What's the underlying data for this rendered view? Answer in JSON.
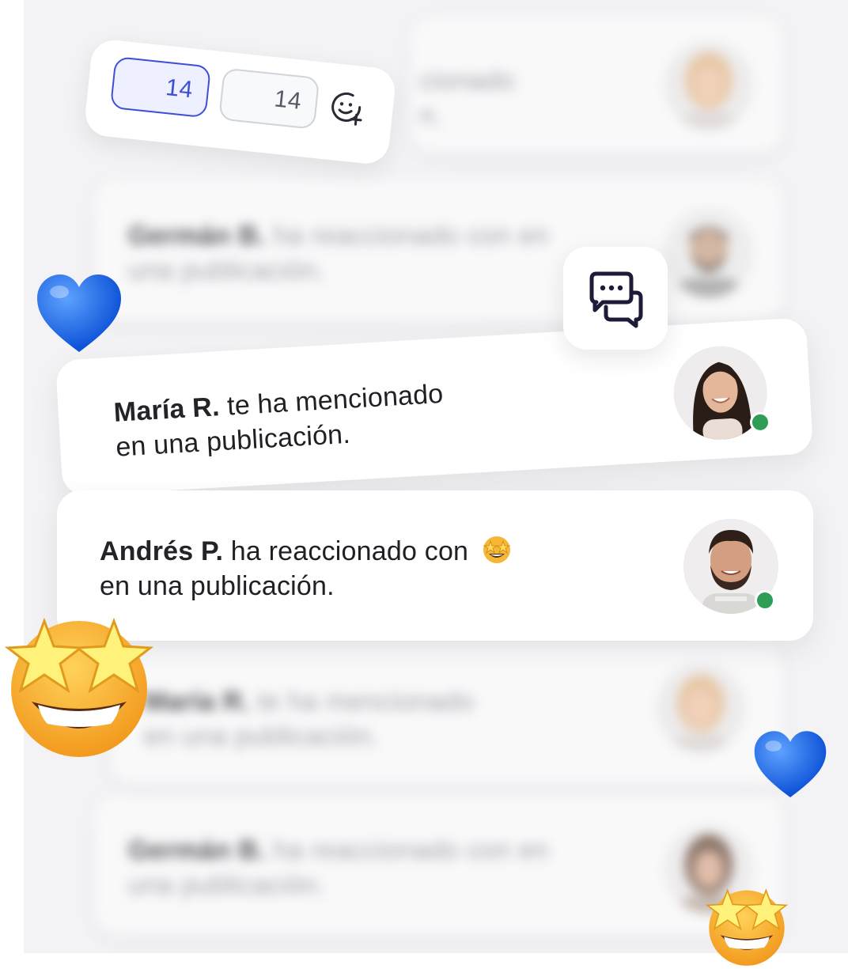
{
  "reactions": {
    "count_primary": "14",
    "count_secondary": "14",
    "add_reaction_icon": "emoji-add-icon"
  },
  "chat_icon": "chat-bubbles-icon",
  "notifications": {
    "focused": [
      {
        "name": "María R.",
        "line1": " te ha mencionado",
        "line2": "en una publicación.",
        "avatar": "woman-avatar",
        "online": true
      },
      {
        "name": "Andrés P.",
        "line1": " ha reaccionado con",
        "emoji": "star-struck-emoji",
        "line2": "en una publicación.",
        "avatar": "man-avatar",
        "online": true
      }
    ],
    "blurred": [
      {
        "name": "Germán B.",
        "line1": " ha reaccionado con  en",
        "line2": "una publicación."
      },
      {
        "name": "María R.",
        "line1": " te ha mencionado",
        "line2": "en una publicación."
      },
      {
        "name": "Germán B.",
        "line1": " ha reaccionado con  en",
        "line2": "una publicación."
      }
    ],
    "top_partial": {
      "line1": "cionado",
      "line2": "n."
    }
  },
  "colors": {
    "accent": "#3d4ed8",
    "accent_bg": "#eef0ff",
    "neutral_border": "#cfd3da",
    "online": "#2e9e57",
    "heart": "#1a6cf0"
  }
}
